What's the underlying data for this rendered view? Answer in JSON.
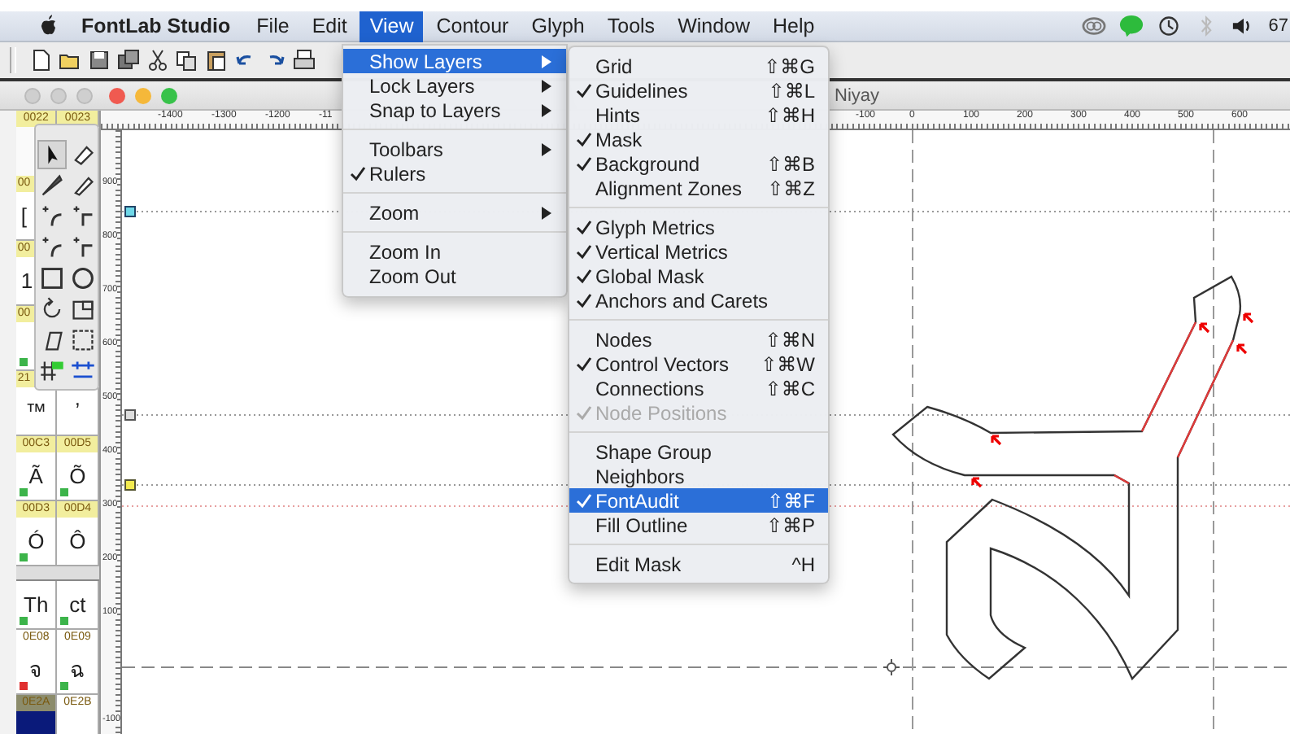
{
  "menu_bar": {
    "items": [
      {
        "kind": "app",
        "label": "FontLab Studio",
        "selected": false
      },
      {
        "kind": "menu",
        "label": "File",
        "selected": false
      },
      {
        "kind": "menu",
        "label": "Edit",
        "selected": false
      },
      {
        "kind": "menu",
        "label": "View",
        "selected": true
      },
      {
        "kind": "menu",
        "label": "Contour",
        "selected": false
      },
      {
        "kind": "menu",
        "label": "Glyph",
        "selected": false
      },
      {
        "kind": "menu",
        "label": "Tools",
        "selected": false
      },
      {
        "kind": "menu",
        "label": "Window",
        "selected": false
      },
      {
        "kind": "menu",
        "label": "Help",
        "selected": false
      }
    ],
    "battery": "67"
  },
  "window": {
    "title": "Niyay"
  },
  "glyph_panel": {
    "rows": [
      {
        "kind": "header",
        "cells": [
          {
            "code": "0022",
            "color": "#f2ee9e"
          },
          {
            "code": "0023",
            "color": "#f2ee9e"
          }
        ]
      },
      {
        "kind": "covered"
      },
      {
        "kind": "header",
        "cells": [
          {
            "code": "00",
            "color": "#f2ee9e"
          }
        ]
      },
      {
        "kind": "glyphs",
        "cells": [
          {
            "char": "[",
            "selected": false
          }
        ]
      },
      {
        "kind": "header",
        "cells": [
          {
            "code": "00",
            "color": "#f2ee9e"
          }
        ]
      },
      {
        "kind": "glyphs",
        "cells": [
          {
            "char": "1",
            "selected": false
          }
        ]
      },
      {
        "kind": "header",
        "cells": [
          {
            "code": "00",
            "color": "#f2ee9e"
          }
        ]
      },
      {
        "kind": "glyphs",
        "cells": [
          {
            "selected": false,
            "color": "#3cb44a"
          }
        ]
      },
      {
        "kind": "header",
        "cells": [
          {
            "code": "21",
            "color": "#f2ee9e"
          }
        ]
      },
      {
        "kind": "glyphs",
        "cells": [
          {
            "char": "™",
            "selected": false
          },
          {
            "char": "ʼ",
            "selected": false
          }
        ]
      },
      {
        "kind": "header",
        "cells": [
          {
            "code": "00C3",
            "color": "#f2ee9e"
          },
          {
            "code": "00D5",
            "color": "#f2ee9e"
          }
        ]
      },
      {
        "kind": "glyphs",
        "cells": [
          {
            "char": "Ã",
            "selected": false,
            "color": "#3cb44a"
          },
          {
            "char": "Õ",
            "selected": false,
            "color": "#3cb44a"
          }
        ]
      },
      {
        "kind": "header",
        "cells": [
          {
            "code": "00D3",
            "color": "#f2ee9e"
          },
          {
            "code": "00D4",
            "color": "#f2ee9e"
          }
        ]
      },
      {
        "kind": "glyphs",
        "cells": [
          {
            "char": "Ó",
            "selected": false,
            "color": "#3cb44a"
          },
          {
            "char": "Ô",
            "selected": false
          }
        ]
      },
      {
        "kind": "divider"
      },
      {
        "kind": "glyphs",
        "cells": [
          {
            "char": "Th",
            "selected": false,
            "color": "#3cb44a"
          },
          {
            "char": "ct",
            "selected": false,
            "color": "#3cb44a"
          }
        ]
      },
      {
        "kind": "header",
        "cells": [
          {
            "code": "0E08",
            "color": "#ffffff"
          },
          {
            "code": "0E09",
            "color": "#ffffff"
          }
        ]
      },
      {
        "kind": "glyphs",
        "cells": [
          {
            "char": "จ",
            "selected": false,
            "color": "#e03030"
          },
          {
            "char": "ฉ",
            "selected": false,
            "color": "#3cb44a"
          }
        ]
      },
      {
        "kind": "header",
        "cells": [
          {
            "code": "0E2A",
            "color": "#8c8c6c"
          },
          {
            "code": "0E2B",
            "color": "#ffffff"
          }
        ]
      },
      {
        "kind": "glyphs",
        "cells": [
          {
            "selected": true
          },
          {
            "selected": false
          }
        ]
      }
    ]
  },
  "ruler": {
    "h_labels": [
      "-1400",
      "-1300",
      "-1200",
      "-11",
      "-100",
      "0",
      "100",
      "200",
      "300",
      "400",
      "500",
      "600"
    ],
    "v_labels": [
      "900",
      "800",
      "700",
      "600",
      "500",
      "400",
      "300",
      "200",
      "100",
      "-100"
    ]
  },
  "view_menu": {
    "items": [
      {
        "kind": "item",
        "label": "Show Layers",
        "checked": false,
        "selected": true,
        "submenu": true
      },
      {
        "kind": "item",
        "label": "Lock Layers",
        "checked": false,
        "selected": false,
        "submenu": true
      },
      {
        "kind": "item",
        "label": "Snap to Layers",
        "checked": false,
        "selected": false,
        "submenu": true
      },
      {
        "kind": "separator"
      },
      {
        "kind": "item",
        "label": "Toolbars",
        "checked": false,
        "selected": false,
        "submenu": true
      },
      {
        "kind": "item",
        "label": "Rulers",
        "checked": true,
        "selected": false,
        "submenu": false
      },
      {
        "kind": "separator"
      },
      {
        "kind": "item",
        "label": "Zoom",
        "checked": false,
        "selected": false,
        "submenu": true
      },
      {
        "kind": "separator"
      },
      {
        "kind": "item",
        "label": "Zoom In",
        "checked": false,
        "selected": false,
        "submenu": false
      },
      {
        "kind": "item",
        "label": "Zoom Out",
        "checked": false,
        "selected": false,
        "submenu": false
      }
    ]
  },
  "show_layers_menu": {
    "items": [
      {
        "kind": "item",
        "label": "Grid",
        "shortcut": "⇧⌘G",
        "checked": false,
        "selected": false,
        "disabled": false
      },
      {
        "kind": "item",
        "label": "Guidelines",
        "shortcut": "⇧⌘L",
        "checked": true,
        "selected": false,
        "disabled": false
      },
      {
        "kind": "item",
        "label": "Hints",
        "shortcut": "⇧⌘H",
        "checked": false,
        "selected": false,
        "disabled": false
      },
      {
        "kind": "item",
        "label": "Mask",
        "checked": true,
        "selected": false,
        "disabled": false
      },
      {
        "kind": "item",
        "label": "Background",
        "shortcut": "⇧⌘B",
        "checked": true,
        "selected": false,
        "disabled": false
      },
      {
        "kind": "item",
        "label": "Alignment Zones",
        "shortcut": "⇧⌘Z",
        "checked": false,
        "selected": false,
        "disabled": false
      },
      {
        "kind": "separator"
      },
      {
        "kind": "item",
        "label": "Glyph Metrics",
        "checked": true,
        "selected": false,
        "disabled": false
      },
      {
        "kind": "item",
        "label": "Vertical Metrics",
        "checked": true,
        "selected": false,
        "disabled": false
      },
      {
        "kind": "item",
        "label": "Global Mask",
        "checked": true,
        "selected": false,
        "disabled": false
      },
      {
        "kind": "item",
        "label": "Anchors and Carets",
        "checked": true,
        "selected": false,
        "disabled": false
      },
      {
        "kind": "separator"
      },
      {
        "kind": "item",
        "label": "Nodes",
        "shortcut": "⇧⌘N",
        "checked": false,
        "selected": false,
        "disabled": false
      },
      {
        "kind": "item",
        "label": "Control Vectors",
        "shortcut": "⇧⌘W",
        "checked": true,
        "selected": false,
        "disabled": false
      },
      {
        "kind": "item",
        "label": "Connections",
        "shortcut": "⇧⌘C",
        "checked": false,
        "selected": false,
        "disabled": false
      },
      {
        "kind": "item",
        "label": "Node Positions",
        "checked": true,
        "selected": false,
        "disabled": true
      },
      {
        "kind": "separator"
      },
      {
        "kind": "item",
        "label": "Shape Group",
        "checked": false,
        "selected": false,
        "disabled": false
      },
      {
        "kind": "item",
        "label": "Neighbors",
        "checked": false,
        "selected": false,
        "disabled": false
      },
      {
        "kind": "item",
        "label": "FontAudit",
        "shortcut": "⇧⌘F",
        "checked": true,
        "selected": true,
        "disabled": false
      },
      {
        "kind": "item",
        "label": "Fill Outline",
        "shortcut": "⇧⌘P",
        "checked": false,
        "selected": false,
        "disabled": false
      },
      {
        "kind": "separator"
      },
      {
        "kind": "item",
        "label": "Edit Mask",
        "shortcut": "^H",
        "checked": false,
        "selected": false,
        "disabled": false
      }
    ]
  }
}
